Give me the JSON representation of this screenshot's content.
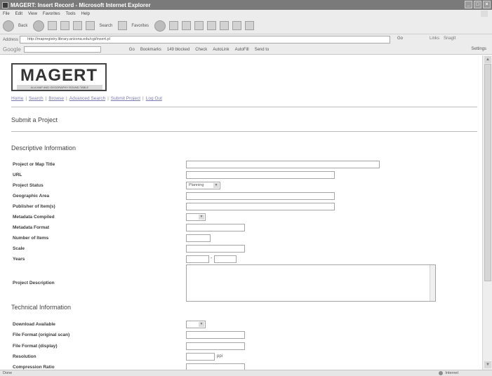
{
  "window": {
    "title": "MAGERT: Insert Record - Microsoft Internet Explorer"
  },
  "menu": [
    "File",
    "Edit",
    "View",
    "Favorites",
    "Tools",
    "Help"
  ],
  "toolbar": {
    "back": "Back",
    "search": "Search",
    "favorites": "Favorites"
  },
  "address": {
    "label": "Address",
    "url": "http://mapregistry.library.arizona.edu/cgi/insert.pl",
    "go": "Go",
    "links": "Links",
    "snagit": "SnagIt"
  },
  "google": {
    "logo": "Google",
    "items": [
      "Go",
      "Bookmarks",
      "149 blocked",
      "Check",
      "AutoLink",
      "AutoFill",
      "Send to"
    ],
    "settings": "Settings"
  },
  "page": {
    "logo_big": "MAGERT",
    "logo_small": "ALA MAP AND GEOGRAPHY ROUND TABLE",
    "nav": [
      "Home",
      "Search",
      "Browse",
      "Advanced Search",
      "Submit Project",
      "Log Out"
    ],
    "title": "Submit a Project",
    "section_descriptive": "Descriptive Information",
    "section_technical": "Technical Information",
    "labels": {
      "project_title": "Project or Map Title",
      "url": "URL",
      "project_status": "Project Status",
      "geographic_area": "Geographic Area",
      "publisher": "Publisher of Item(s)",
      "metadata_compiled": "Metadata Compiled",
      "metadata_format": "Metadata Format",
      "number_of_items": "Number of Items",
      "scale": "Scale",
      "years": "Years",
      "project_description": "Project Description",
      "download_available": "Download Available",
      "file_format_original": "File Format (original scan)",
      "file_format_display": "File Format (display)",
      "resolution": "Resolution",
      "compression_ratio": "Compression Ratio"
    },
    "project_status_value": "Planning",
    "years_separator": "-",
    "resolution_unit": "ppi"
  },
  "status": {
    "left": "Done",
    "zone": "Internet"
  }
}
